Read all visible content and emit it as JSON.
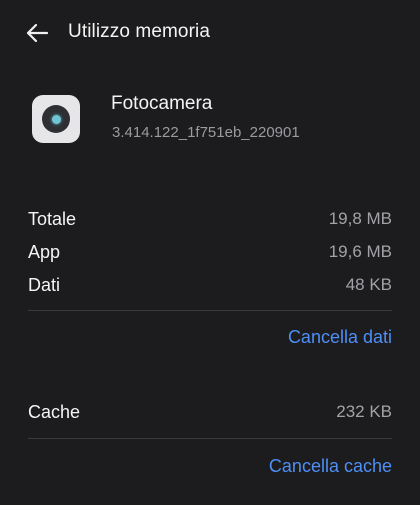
{
  "header": {
    "title": "Utilizzo memoria",
    "back_icon": "arrow-left-icon"
  },
  "app": {
    "name": "Fotocamera",
    "version": "3.414.122_1f751eb_220901",
    "icon": "camera-app-icon"
  },
  "storage": {
    "rows": [
      {
        "label": "Totale",
        "value": "19,8 MB"
      },
      {
        "label": "App",
        "value": "19,6 MB"
      },
      {
        "label": "Dati",
        "value": "48 KB"
      }
    ],
    "clear_data_label": "Cancella dati"
  },
  "cache": {
    "label": "Cache",
    "value": "232 KB",
    "clear_cache_label": "Cancella cache"
  },
  "colors": {
    "background": "#1c1c1e",
    "accent": "#4d8ff6",
    "secondary_text": "#a3a3a7"
  }
}
